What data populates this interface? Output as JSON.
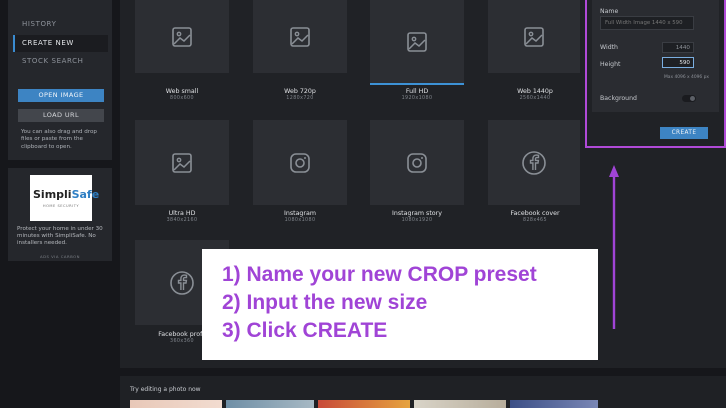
{
  "sidebar": {
    "nav": [
      {
        "label": "HISTORY"
      },
      {
        "label": "CREATE NEW"
      },
      {
        "label": "STOCK SEARCH"
      }
    ],
    "open_image_label": "OPEN IMAGE",
    "load_url_label": "LOAD URL",
    "drag_hint_lines": [
      "You can also drag and drop",
      "files or paste from the",
      "clipboard to open."
    ]
  },
  "ad": {
    "brand_a": "Simpli",
    "brand_b": "Safe",
    "brand_sub": "HOME SECURITY",
    "text_lines": [
      "Protect your home in under 30",
      "minutes with SimpliSafe. No",
      "installers needed."
    ],
    "via": "ADS VIA CARBON"
  },
  "presets": [
    {
      "name": "Web small",
      "size": "800x600",
      "icon": "image-icon"
    },
    {
      "name": "Web 720p",
      "size": "1280x720",
      "icon": "image-icon"
    },
    {
      "name": "Full HD",
      "size": "1920x1080",
      "icon": "image-icon",
      "selected": true
    },
    {
      "name": "Web 1440p",
      "size": "2560x1440",
      "icon": "image-icon"
    },
    {
      "name": "Ultra HD",
      "size": "3840x2160",
      "icon": "image-icon"
    },
    {
      "name": "Instagram",
      "size": "1080x1080",
      "icon": "instagram-icon"
    },
    {
      "name": "Instagram story",
      "size": "1080x1920",
      "icon": "instagram-icon"
    },
    {
      "name": "Facebook cover",
      "size": "828x465",
      "icon": "facebook-icon"
    },
    {
      "name": "Facebook profil",
      "size": "360x360",
      "icon": "facebook-icon"
    }
  ],
  "panel": {
    "name_label": "Name",
    "name_placeholder": "Full Width Image 1440 x 590",
    "width_label": "Width",
    "width_value": "1440",
    "height_label": "Height",
    "height_value": "590",
    "max_text": "Max 4096 x 4096 px",
    "background_label": "Background",
    "background_on": false,
    "create_label": "CREATE"
  },
  "callout": {
    "lines": [
      "1) Name your new CROP preset",
      "2) Input the new size",
      "3) Click CREATE"
    ],
    "color": "#a044d6"
  },
  "gallery": {
    "title": "Try editing a photo now"
  },
  "colors": {
    "accent_blue": "#3d84c3",
    "highlight_purple": "#b04ad8"
  }
}
